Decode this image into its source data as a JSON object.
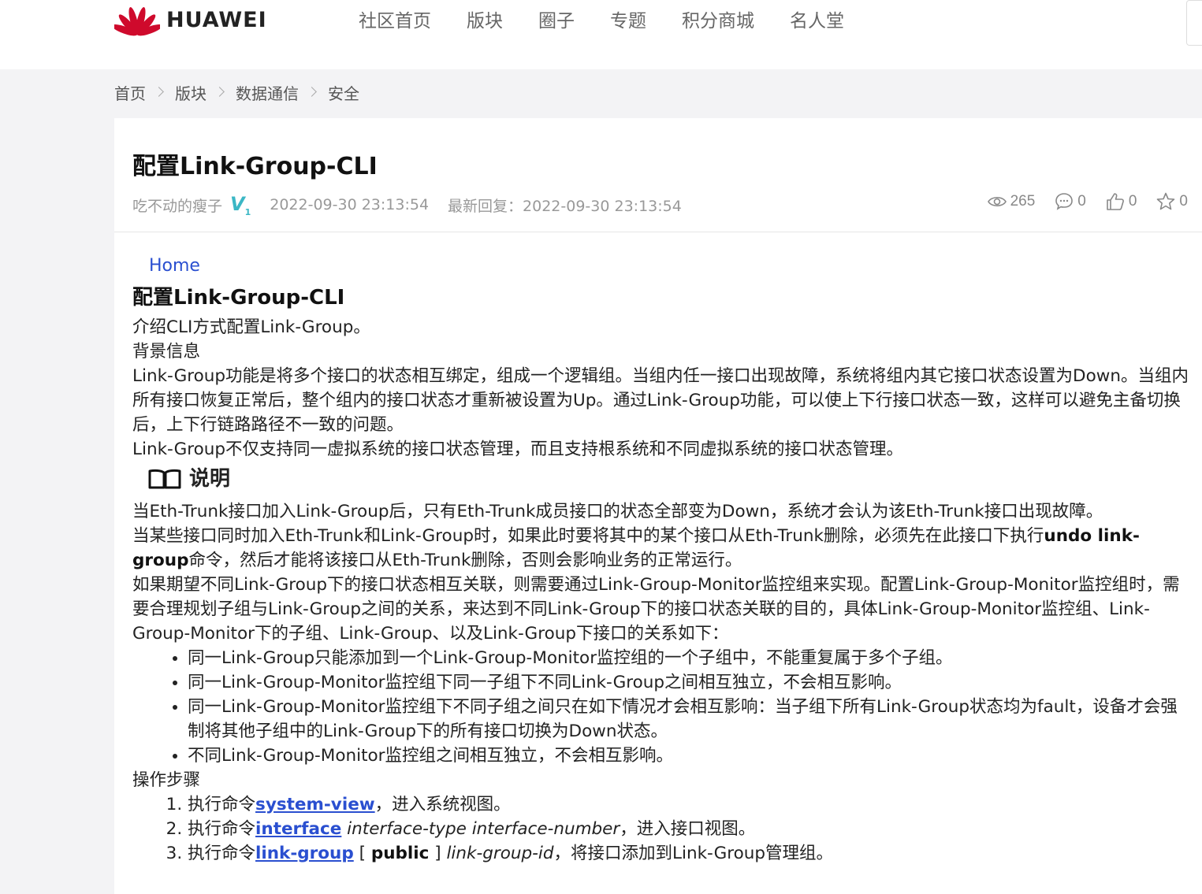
{
  "brand": {
    "name": "HUAWEI",
    "color": "#cf0a2c"
  },
  "nav": [
    "社区首页",
    "版块",
    "圈子",
    "专题",
    "积分商城",
    "名人堂"
  ],
  "breadcrumb": [
    "首页",
    "版块",
    "数据通信",
    "安全"
  ],
  "post": {
    "title": "配置Link-Group-CLI",
    "author": "吃不动的瘦子",
    "level_mark": "V",
    "level_num": "1",
    "posted": "2022-09-30 23:13:54",
    "last_reply": "最新回复：2022-09-30 23:13:54",
    "views": "265",
    "comments": "0",
    "likes": "0",
    "favorites": "0"
  },
  "content": {
    "home_link": "Home",
    "heading": "配置Link-Group-CLI",
    "intro": "介绍CLI方式配置Link-Group。",
    "bg_title": "背景信息",
    "bg_p1": "Link-Group功能是将多个接口的状态相互绑定，组成一个逻辑组。当组内任一接口出现故障，系统将组内其它接口状态设置为Down。当组内所有接口恢复正常后，整个组内的接口状态才重新被设置为Up。通过Link-Group功能，可以使上下行接口状态一致，这样可以避免主备切换后，上下行链路路径不一致的问题。",
    "bg_p2": "Link-Group不仅支持同一虚拟系统的接口状态管理，而且支持根系统和不同虚拟系统的接口状态管理。",
    "note_label": "说明",
    "note_p1": "当Eth-Trunk接口加入Link-Group后，只有Eth-Trunk成员接口的状态全部变为Down，系统才会认为该Eth-Trunk接口出现故障。",
    "note_p2_a": "当某些接口同时加入Eth-Trunk和Link-Group时，如果此时要将其中的某个接口从Eth-Trunk删除，必须先在此接口下执行",
    "note_p2_cmd": "undo link-group",
    "note_p2_b": "命令，然后才能将该接口从Eth-Trunk删除，否则会影响业务的正常运行。",
    "note_p3": "如果期望不同Link-Group下的接口状态相互关联，则需要通过Link-Group-Monitor监控组来实现。配置Link-Group-Monitor监控组时，需要合理规划子组与Link-Group之间的关系，来达到不同Link-Group下的接口状态关联的目的，具体Link-Group-Monitor监控组、Link-Group-Monitor下的子组、Link-Group、以及Link-Group下接口的关系如下：",
    "bullets": [
      "同一Link-Group只能添加到一个Link-Group-Monitor监控组的一个子组中，不能重复属于多个子组。",
      "同一Link-Group-Monitor监控组下同一子组下不同Link-Group之间相互独立，不会相互影响。",
      "同一Link-Group-Monitor监控组下不同子组之间只在如下情况才会相互影响：当子组下所有Link-Group状态均为fault，设备才会强制将其他子组中的Link-Group下的所有接口切换为Down状态。",
      "不同Link-Group-Monitor监控组之间相互独立，不会相互影响。"
    ],
    "steps_title": "操作步骤",
    "steps": [
      {
        "pre": "执行命令",
        "cmd": "system-view",
        "post": "，进入系统视图。"
      },
      {
        "pre": "执行命令",
        "cmd": "interface",
        "param": " interface-type interface-number",
        "post": "，进入接口视图。"
      },
      {
        "pre": "执行命令",
        "cmd": "link-group",
        "open": " [ ",
        "kw": "public",
        "close": " ] ",
        "param": "link-group-id",
        "post": "，将接口添加到Link-Group管理组。"
      }
    ]
  }
}
